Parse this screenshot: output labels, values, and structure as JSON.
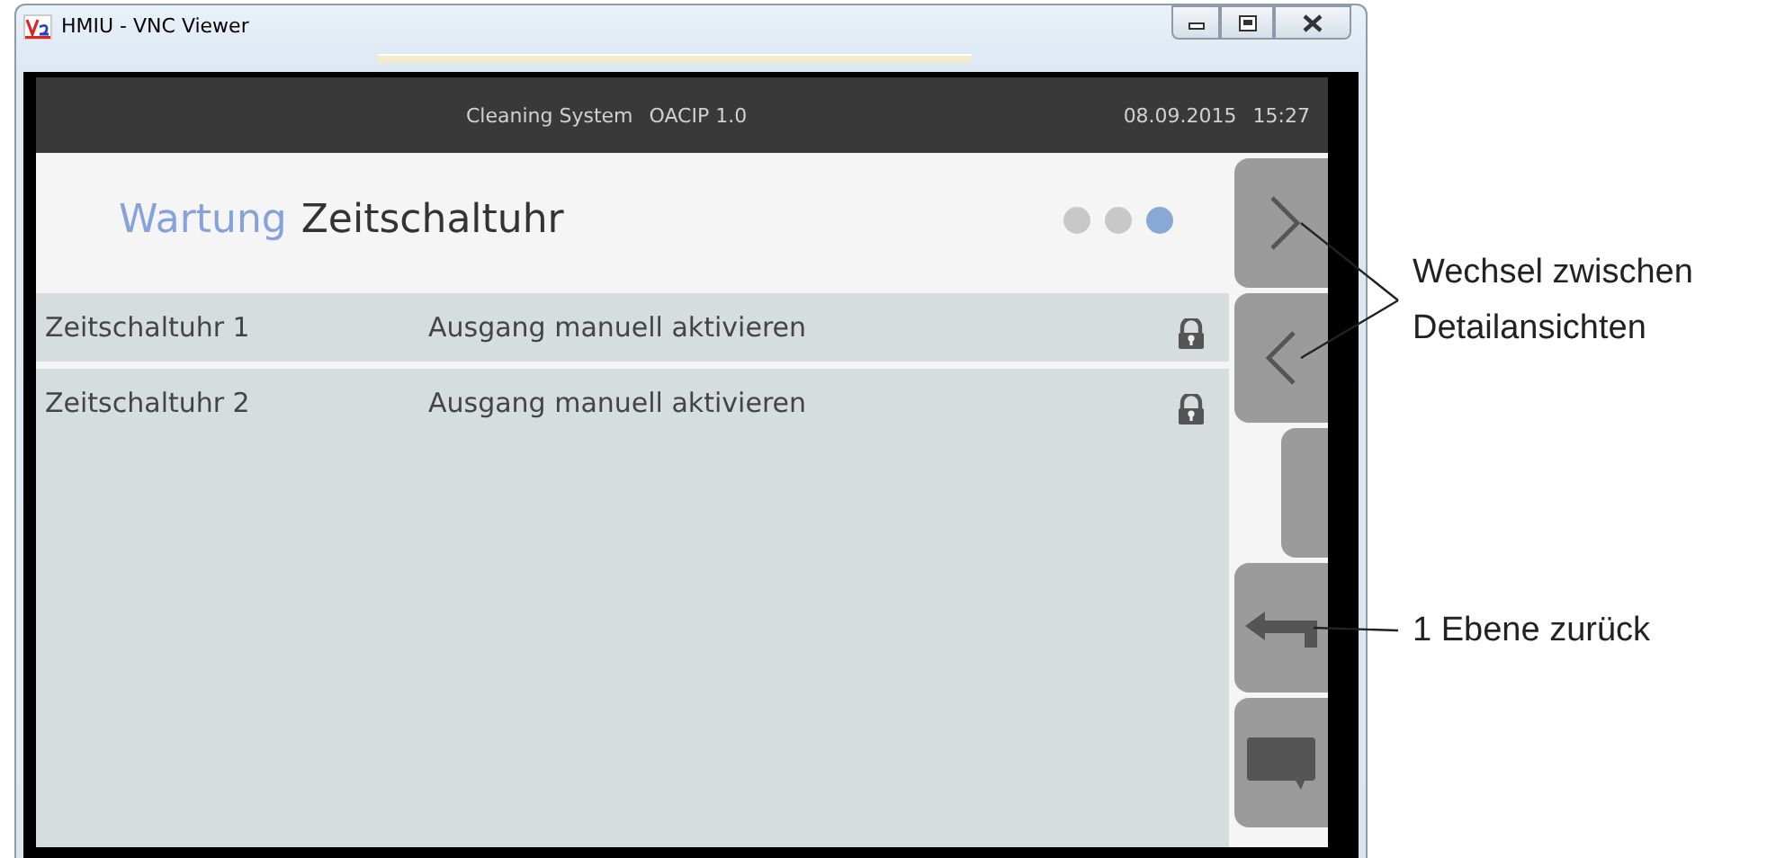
{
  "window": {
    "title": "HMIU - VNC Viewer"
  },
  "header": {
    "system": "Cleaning System",
    "version": "OACIP 1.0",
    "date": "08.09.2015",
    "time": "15:27"
  },
  "page": {
    "section": "Wartung",
    "title": "Zeitschaltuhr",
    "pages": [
      {
        "selected": false
      },
      {
        "selected": false
      },
      {
        "selected": true
      }
    ]
  },
  "rows": [
    {
      "name": "Zeitschaltuhr 1",
      "action": "Ausgang manuell aktivieren",
      "locked": true
    },
    {
      "name": "Zeitschaltuhr 2",
      "action": "Ausgang manuell aktivieren",
      "locked": true
    }
  ],
  "side_buttons": [
    {
      "kind": "next"
    },
    {
      "kind": "previous"
    },
    {
      "kind": "blank"
    },
    {
      "kind": "back"
    },
    {
      "kind": "message"
    }
  ],
  "annotations": [
    {
      "text": "Wechsel zwischen Detailansichten",
      "kind": "switch"
    },
    {
      "text": "1 Ebene zurück",
      "kind": "back"
    }
  ]
}
